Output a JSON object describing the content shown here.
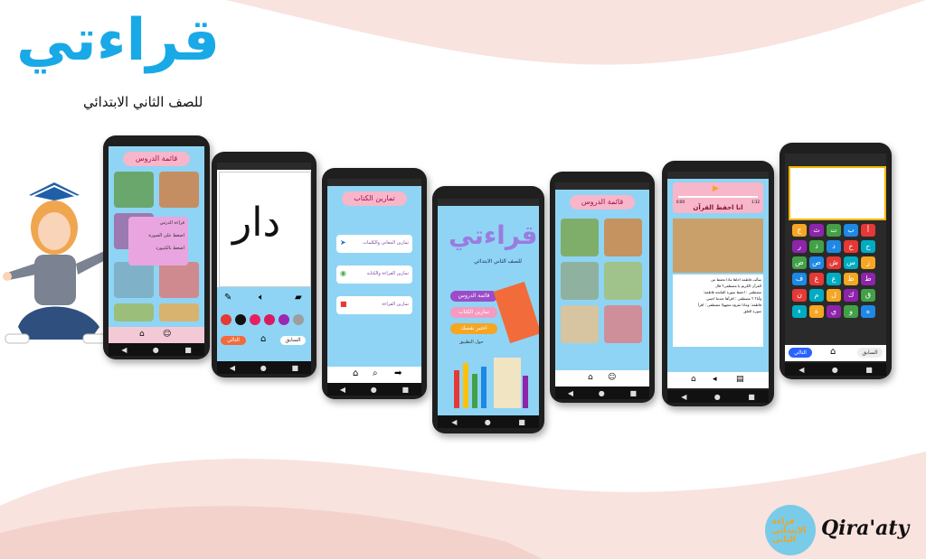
{
  "hero": {
    "title": "قراءتي",
    "subtitle": "للصف الثاني الابتدائي"
  },
  "brand": {
    "name": "Qira'aty",
    "logo_text": "قراءة الابتدائي الثاني"
  },
  "phone1": {
    "header": "قائمة الدروس",
    "menu_items": [
      "قراءة الدرس",
      "اضغط على الصورة",
      "اضغط بالكيبورد"
    ]
  },
  "phone2": {
    "drawn_text": "دار",
    "next_label": "التالي",
    "prev_label": "السابق"
  },
  "phone3": {
    "header": "تمارين الكتاب",
    "items": [
      "تمارين المعاني والكلمات",
      "تمارين القراءة والكتابة",
      "تمارين القراءة"
    ]
  },
  "phone4": {
    "title": "قراءتي",
    "subtitle": "للصف الثاني الابتدائي",
    "buttons": [
      "قائمة الدروس",
      "تمارين الكتاب",
      "اختبر نفسك"
    ],
    "footer": "حول التطبيق"
  },
  "phone5": {
    "header": "قائمة الدروس"
  },
  "phone6": {
    "lesson_title": "انا احفظ القرآن",
    "time_start": "0:00",
    "time_end": "1:32",
    "body_lines": [
      "سألت فاطمة اخاها ماذا تحفظ من",
      "القرآن الكريم يا مصطفى؟ قال",
      "مصطفى : احفظ سورة الفاتحة فاطمة:",
      "وأنا؟ ؟ مصطفى : اقرأها عندما احبني",
      "فاطمة: وماذا تقرؤه مجهولا مصطفى : اقرأ",
      "سورة العلق"
    ]
  },
  "phone7": {
    "letters": [
      "أ",
      "ب",
      "ت",
      "ث",
      "ج",
      "ح",
      "خ",
      "د",
      "ذ",
      "ر",
      "ز",
      "س",
      "ش",
      "ص",
      "ض",
      "ط",
      "ظ",
      "ع",
      "غ",
      "ف",
      "ق",
      "ك",
      "ل",
      "م",
      "ن",
      "ه",
      "و",
      "ي",
      "ة",
      "ء"
    ],
    "next_label": "التالي",
    "prev_label": "السابق"
  },
  "colors": {
    "accent_blue": "#19a9e6",
    "pink": "#f7b6c9",
    "screen_blue": "#8fd4f4",
    "wave_pink": "#f8e3df"
  }
}
